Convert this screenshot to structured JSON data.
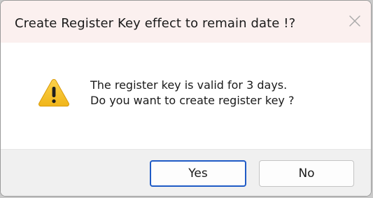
{
  "dialog": {
    "title": "Create Register Key effect to remain date !?",
    "close_icon": "close-icon",
    "icon": "warning-icon",
    "message_line1": "The register key is valid for 3 days.",
    "message_line2": "Do you want to create register key ?",
    "buttons": {
      "yes_label": "Yes",
      "no_label": "No"
    }
  },
  "colors": {
    "title_bar_bg": "#fbf0ef",
    "footer_bg": "#f0f0f0",
    "default_button_border": "#1f5bc6",
    "warning_fill": "#f5c02b"
  }
}
